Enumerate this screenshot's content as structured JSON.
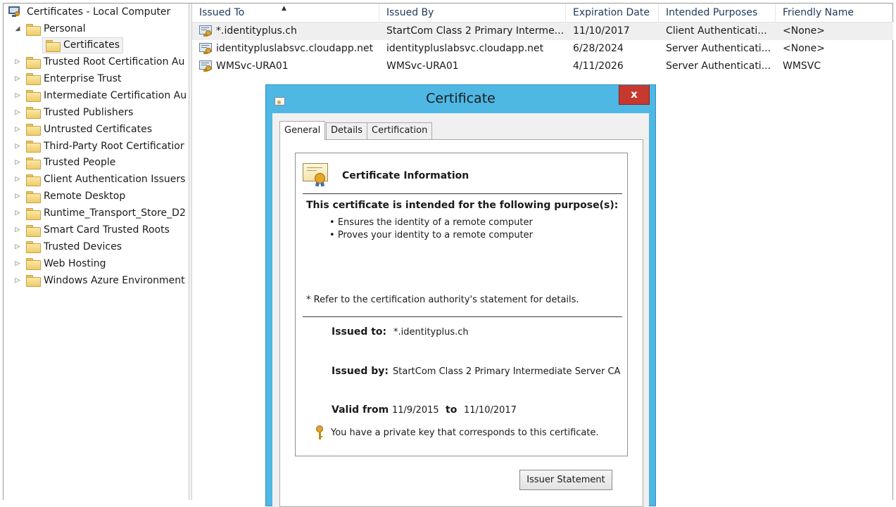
{
  "tree": {
    "root": "Certificates - Local Computer",
    "personal": "Personal",
    "personal_child": "Certificates",
    "items": [
      "Trusted Root Certification Au",
      "Enterprise Trust",
      "Intermediate Certification Au",
      "Trusted Publishers",
      "Untrusted Certificates",
      "Third-Party Root Certificatior",
      "Trusted People",
      "Client Authentication Issuers",
      "Remote Desktop",
      "Runtime_Transport_Store_D2",
      "Smart Card Trusted Roots",
      "Trusted Devices",
      "Web Hosting",
      "Windows Azure Environment"
    ]
  },
  "list": {
    "columns": [
      "Issued To",
      "Issued By",
      "Expiration Date",
      "Intended Purposes",
      "Friendly Name"
    ],
    "rows": [
      [
        "*.identityplus.ch",
        "StartCom Class 2 Primary Interme...",
        "11/10/2017",
        "Client Authenticati...",
        "<None>"
      ],
      [
        "identitypluslabsvc.cloudapp.net",
        "identitypluslabsvc.cloudapp.net",
        "6/28/2024",
        "Server Authenticati...",
        "<None>"
      ],
      [
        "WMSvc-URA01",
        "WMSvc-URA01",
        "4/11/2026",
        "Server Authenticati...",
        "WMSVC"
      ]
    ]
  },
  "dialog": {
    "title": "Certificate",
    "close": "x",
    "tabs": [
      "General",
      "Details",
      "Certification Path"
    ],
    "info_title": "Certificate Information",
    "purpose_heading": "This certificate is intended for the following purpose(s):",
    "purposes": [
      "Ensures the identity of a remote computer",
      "Proves your identity to a remote computer"
    ],
    "refer_note": "* Refer to the certification authority's statement for details.",
    "issued_to_label": "Issued to:",
    "issued_to": "*.identityplus.ch",
    "issued_by_label": "Issued by:",
    "issued_by": "StartCom Class 2 Primary Intermediate Server CA",
    "valid_from_label": "Valid from",
    "valid_from": "11/9/2015",
    "valid_to_label": "to",
    "valid_to": "11/10/2017",
    "private_key_note": "You have a private key that corresponds to this certificate.",
    "issuer_button": "Issuer Statement"
  },
  "icons": {
    "root": "computer-certificate-icon",
    "folder": "folder-icon",
    "certificate": "certificate-icon",
    "key": "key-icon"
  },
  "colors": {
    "dialog_frame": "#4fb7e4",
    "close_button": "#c7392f",
    "header_text": "#1e395b"
  }
}
